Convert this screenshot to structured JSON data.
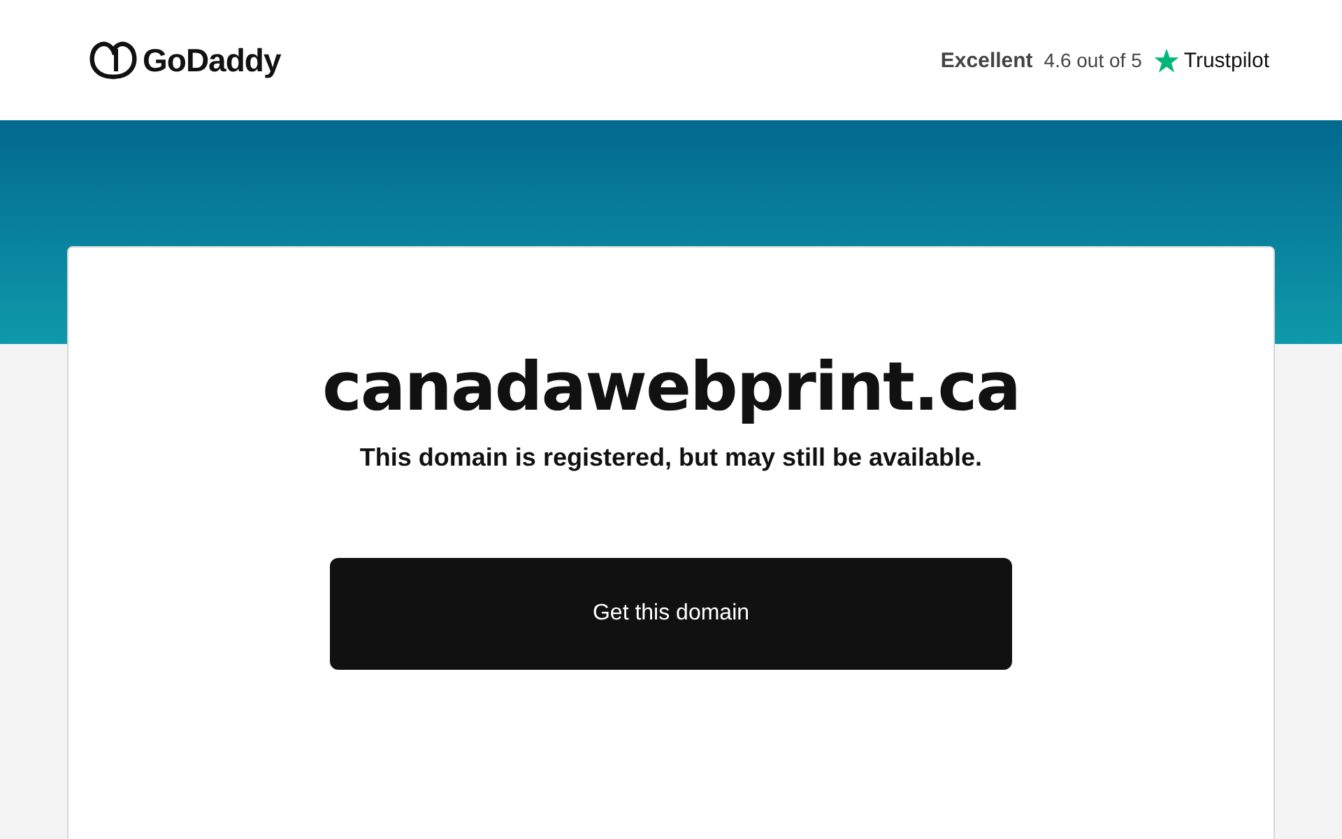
{
  "header": {
    "logo": "GoDaddy",
    "rating": {
      "label": "Excellent",
      "score": "4.6 out of 5",
      "brand": "Trustpilot"
    }
  },
  "card": {
    "domain": "canadawebprint.ca",
    "message": "This domain is registered, but may still be available.",
    "button": "Get this domain"
  }
}
